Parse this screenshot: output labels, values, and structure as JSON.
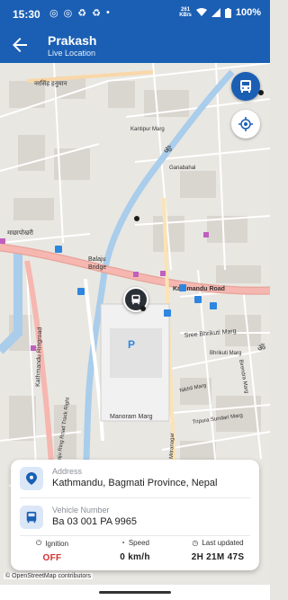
{
  "status_bar": {
    "time": "15:30",
    "data_rate_top": "261",
    "data_rate_bottom": "KB/s",
    "battery": "100%"
  },
  "app_bar": {
    "title": "Prakash",
    "subtitle": "Live Location"
  },
  "map": {
    "labels": {
      "kathmandu_road": "Kathmandu Road",
      "ringroad_left": "Kathmandu Ringroad",
      "ringroad_track": "Balaju Ring Road Track Right",
      "balaju_bridge": "Balaju Bridge",
      "balaju_bridge_line1": "Balaju",
      "balaju_bridge_line2": "Bridge",
      "sree_bhrikuti": "Sree Bhrikuti Marg",
      "bhrikuti_marg": "Bhrikuti Marg",
      "nikhil_marg": "Nikhil Marg",
      "manoram_marg": "Manoram Marg",
      "tripura_sundari": "Tripura Sundari Marg",
      "birendra_marg": "Birendra Marg",
      "mitranagar": "Mitranagar",
      "kantipur_marg": "Kantipur Marg",
      "ganabahal": "Ganabahal",
      "parking": "P",
      "nepali_top": "नरसिंह हनुमान",
      "nepali_left": "माछापोखरी"
    },
    "attribution": "© OpenStreetMap contributors"
  },
  "info_card": {
    "address_label": "Address",
    "address_value": "Kathmandu, Bagmati Province, Nepal",
    "vehicle_label": "Vehicle Number",
    "vehicle_value": "Ba 03 001 PA 9965",
    "ignition_label": "Ignition",
    "ignition_value": "OFF",
    "speed_label": "Speed",
    "speed_value": "0 km/h",
    "updated_label": "Last updated",
    "updated_value": "2H 21M 47S"
  },
  "colors": {
    "primary": "#1a5fb4",
    "ignition_off": "#d32f2f",
    "river": "#a9cdeb",
    "main_road": "#f5b7b0",
    "secondary_road": "#ffffff"
  }
}
